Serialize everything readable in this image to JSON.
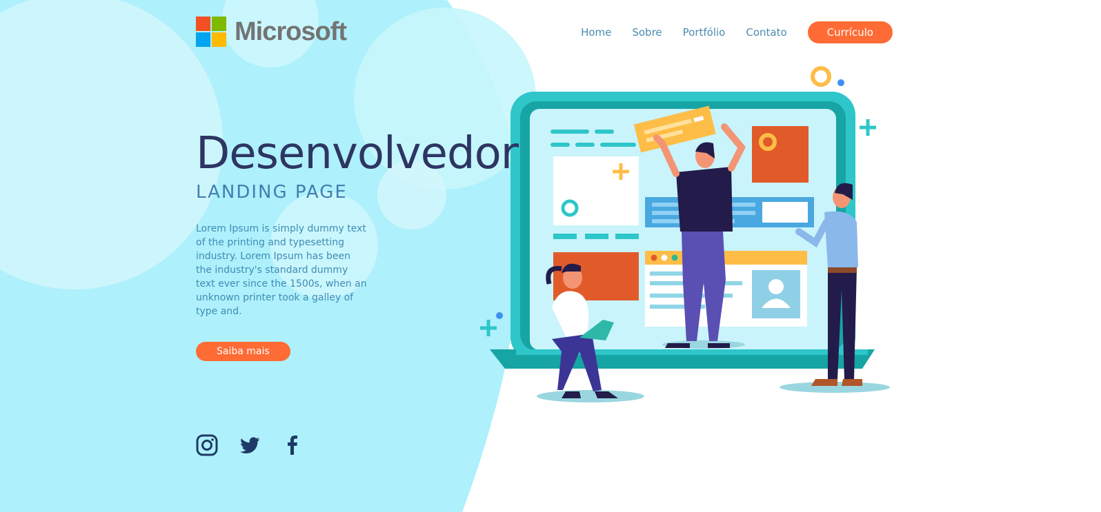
{
  "header": {
    "logo_text": "Microsoft",
    "nav": [
      "Home",
      "Sobre",
      "Portfólio",
      "Contato"
    ],
    "cta_label": "Currículo"
  },
  "hero": {
    "title": "Desenvolvedor",
    "subtitle": "LANDING PAGE",
    "description": "Lorem Ipsum is simply dummy text of the printing and typesetting industry. Lorem Ipsum has been the industry's standard dummy text ever since the 1500s, when an unknown printer took a galley of type and.",
    "button_label": "Saiba mais"
  },
  "social": {
    "icons": [
      "instagram-icon",
      "twitter-icon",
      "facebook-icon"
    ]
  },
  "colors": {
    "background_blob": "#aef0fb",
    "accent": "#ff6b35",
    "title": "#2e3562",
    "text": "#3f8cb5",
    "logo_red": "#f25022",
    "logo_green": "#7fba00",
    "logo_blue": "#00a4ef",
    "logo_yellow": "#ffb900"
  }
}
